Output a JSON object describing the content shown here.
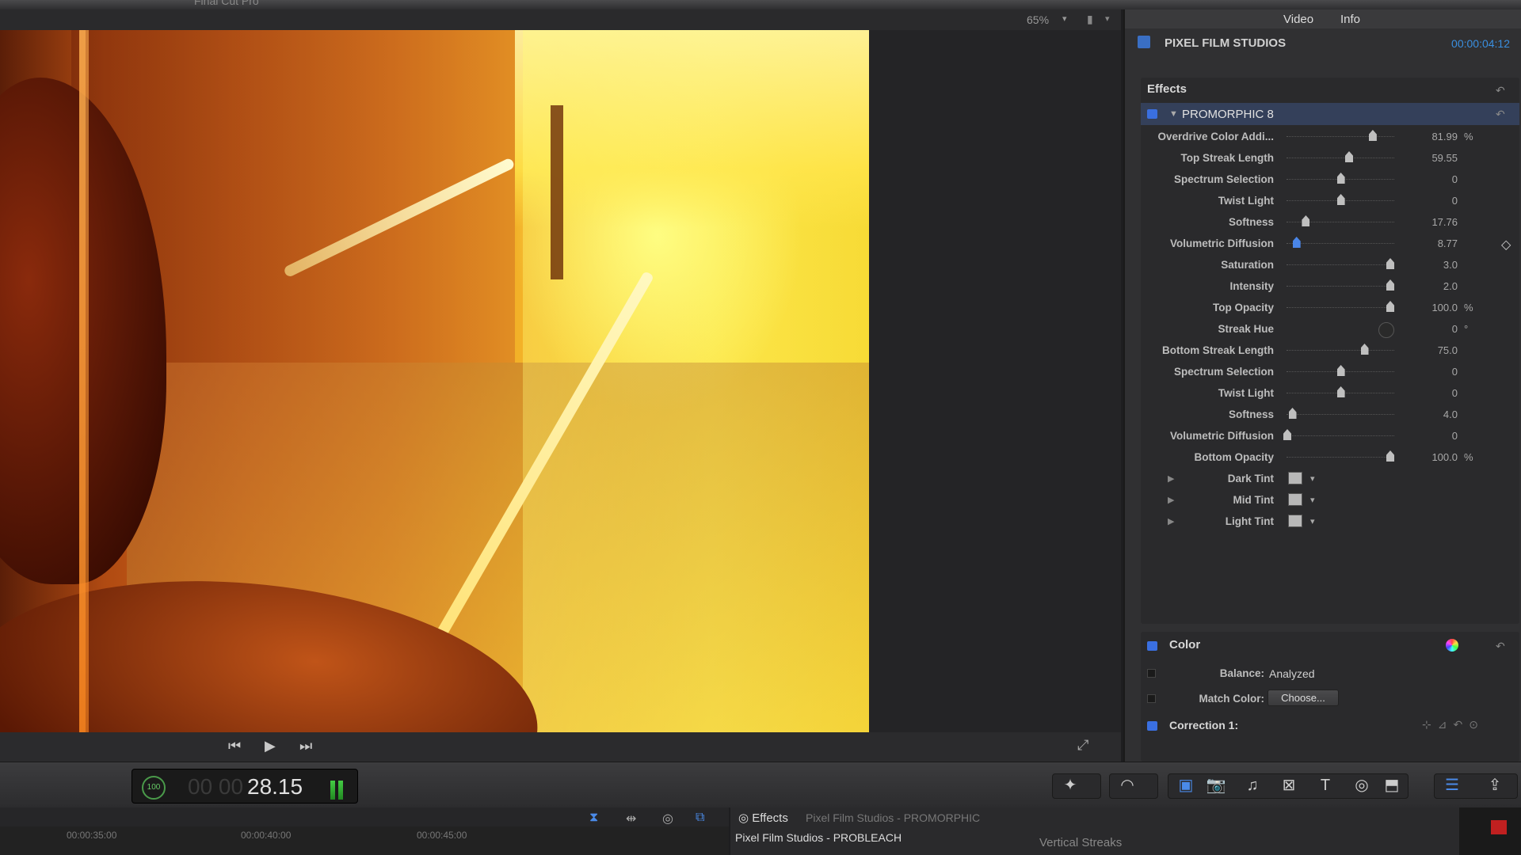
{
  "app": {
    "title": "Final Cut Pro"
  },
  "viewer": {
    "zoom": "65%",
    "zoom_arrow": "▾",
    "view_icon": "▮",
    "view_arrow": "▾"
  },
  "transport": {
    "prev": "⏮",
    "play": "▶",
    "next": "⏭",
    "fullscreen": "⤢"
  },
  "inspector": {
    "tabs": [
      "Video",
      "Info"
    ],
    "clip_name": "PIXEL FILM STUDIOS",
    "clip_timecode": "00:00:04:12",
    "effects_title": "Effects",
    "effect_name": "PROMORPHIC 8",
    "reset_glyph": "↶",
    "params": [
      {
        "label": "Overdrive Color Addi...",
        "value": "81.99",
        "unit": "%",
        "pos": 0.83
      },
      {
        "label": "Top Streak Length",
        "value": "59.55",
        "unit": "",
        "pos": 0.6
      },
      {
        "label": "Spectrum Selection",
        "value": "0",
        "unit": "",
        "pos": 0.52
      },
      {
        "label": "Twist Light",
        "value": "0",
        "unit": "",
        "pos": 0.52
      },
      {
        "label": "Softness",
        "value": "17.76",
        "unit": "",
        "pos": 0.18
      },
      {
        "label": "Volumetric Diffusion",
        "value": "8.77",
        "unit": "",
        "pos": 0.09,
        "active": true
      },
      {
        "label": "Saturation",
        "value": "3.0",
        "unit": "",
        "pos": 1.0
      },
      {
        "label": "Intensity",
        "value": "2.0",
        "unit": "",
        "pos": 1.0
      },
      {
        "label": "Top Opacity",
        "value": "100.0",
        "unit": "%",
        "pos": 1.0
      },
      {
        "label": "Streak Hue",
        "value": "0",
        "unit": "°",
        "dial": true
      },
      {
        "label": "Bottom Streak Length",
        "value": "75.0",
        "unit": "",
        "pos": 0.75
      },
      {
        "label": "Spectrum Selection",
        "value": "0",
        "unit": "",
        "pos": 0.52
      },
      {
        "label": "Twist Light",
        "value": "0",
        "unit": "",
        "pos": 0.52
      },
      {
        "label": "Softness",
        "value": "4.0",
        "unit": "",
        "pos": 0.05
      },
      {
        "label": "Volumetric Diffusion",
        "value": "0",
        "unit": "",
        "pos": 0.0
      },
      {
        "label": "Bottom Opacity",
        "value": "100.0",
        "unit": "%",
        "pos": 1.0
      }
    ],
    "tints": [
      "Dark Tint",
      "Mid Tint",
      "Light Tint"
    ],
    "keyframe_glyph": "◇",
    "color": {
      "title": "Color",
      "balance_label": "Balance:",
      "balance_value": "Analyzed",
      "match_label": "Match Color:",
      "match_button": "Choose...",
      "correction_label": "Correction 1:"
    }
  },
  "toolbar": {
    "tc_badge": "100",
    "tc_dim": "00 00",
    "tc_main": "28.15",
    "buttons": [
      "✦",
      "◠",
      "▣",
      "📷",
      "♫",
      "⊠",
      "T",
      "◎",
      "⬒",
      "☰",
      "⇪"
    ]
  },
  "timeline": {
    "ruler": [
      "00:00:35:00",
      "00:00:40:00",
      "00:00:45:00"
    ]
  },
  "browser": {
    "title": "Effects",
    "subtitle": "Pixel Film Studios - PROMORPHIC",
    "item": "Pixel Film Studios - PROBLEACH",
    "right": "Vertical Streaks"
  }
}
